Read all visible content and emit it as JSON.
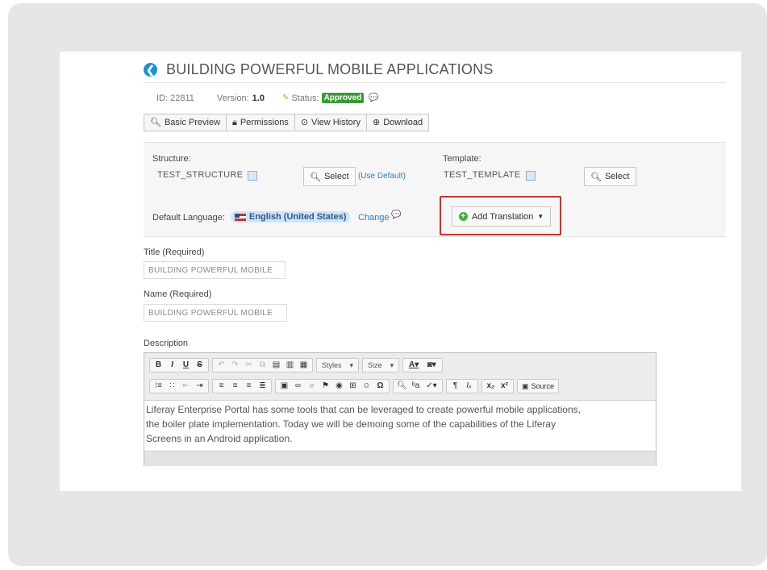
{
  "header": {
    "title": "BUILDING POWERFUL MOBILE APPLICATIONS",
    "back_icon": "arrow-left-circle-icon"
  },
  "meta": {
    "id_label": "ID: 22811",
    "version_label": "Version:",
    "version_value": "1.0",
    "status_label": "Status:",
    "status_value": "Approved"
  },
  "actions": [
    {
      "label": "Basic Preview",
      "icon": "search-icon"
    },
    {
      "label": "Permissions",
      "icon": "lock-icon"
    },
    {
      "label": "View History",
      "icon": "history-icon"
    },
    {
      "label": "Download",
      "icon": "download-icon"
    }
  ],
  "structure": {
    "label": "Structure:",
    "value": "TEST_STRUCTURE",
    "select_label": "Select",
    "default_link": "(Use Default)"
  },
  "template": {
    "label": "Template:",
    "value": "TEST_TEMPLATE",
    "select_label": "Select"
  },
  "language": {
    "label": "Default Language:",
    "value": "English (United States)",
    "change_link": "Change"
  },
  "add_translation": {
    "label": "Add Translation"
  },
  "title_field": {
    "label": "Title (Required)",
    "value": "BUILDING POWERFUL MOBILE"
  },
  "name_field": {
    "label": "Name (Required)",
    "value": "BUILDING POWERFUL MOBILE"
  },
  "description": {
    "label": "Description",
    "styles_label": "Styles",
    "size_label": "Size",
    "source_label": "Source",
    "lines": [
      "Liferay Enterprise Portal has some tools that can be leveraged to create powerful mobile applications,",
      "the boiler plate implementation. Today we will be demoing some of the capabilities of the Liferay",
      "Screens in an Android application."
    ]
  },
  "colors": {
    "accent": "#1e90d9",
    "approved": "#3a9a36",
    "highlight": "#c0392b",
    "link": "#2a7fc6"
  }
}
